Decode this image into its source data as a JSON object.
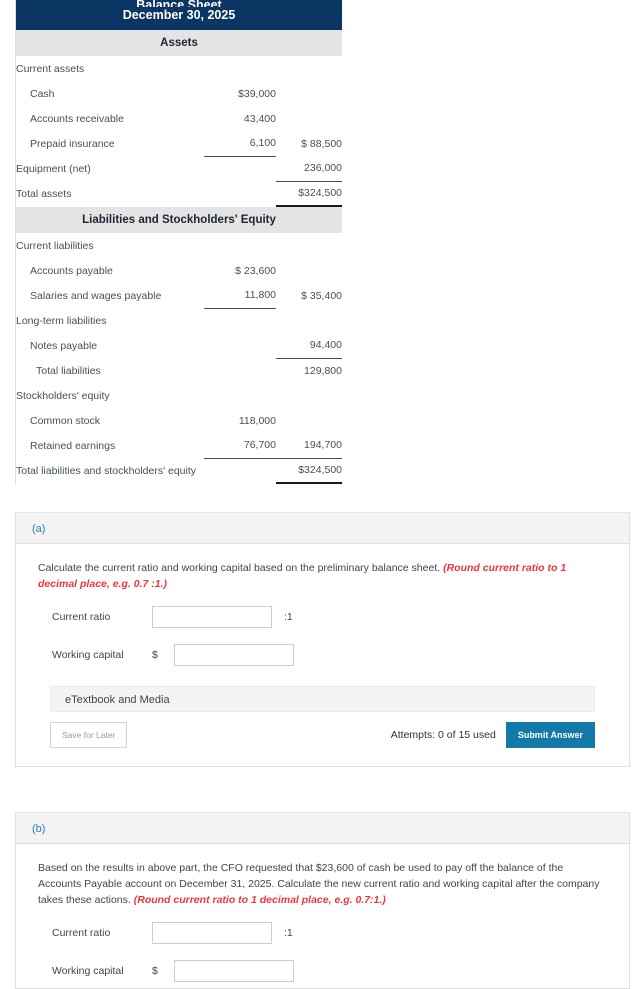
{
  "balance_sheet": {
    "title_line1": "Balance Sheet",
    "title_line2": "December 30, 2025",
    "assets_section": "Assets",
    "liabilities_section": "Liabilities and Stockholders' Equity",
    "asset_rows": [
      {
        "label": "Current assets",
        "col1": "",
        "col2": ""
      },
      {
        "label": "Cash",
        "col1": "$39,000",
        "col2": ""
      },
      {
        "label": "Accounts receivable",
        "col1": "43,400",
        "col2": ""
      },
      {
        "label": "Prepaid insurance",
        "col1": "6,100",
        "col2": "$ 88,500"
      },
      {
        "label": "Equipment (net)",
        "col1": "",
        "col2": "236,000"
      },
      {
        "label": "Total assets",
        "col1": "",
        "col2": "$324,500"
      }
    ],
    "liability_rows": [
      {
        "label": "Current liabilities",
        "col1": "",
        "col2": ""
      },
      {
        "label": "Accounts payable",
        "col1": "$ 23,600",
        "col2": ""
      },
      {
        "label": "Salaries and wages payable",
        "col1": "11,800",
        "col2": "$ 35,400"
      },
      {
        "label": "Long-term liabilities",
        "col1": "",
        "col2": ""
      },
      {
        "label": "Notes payable",
        "col1": "",
        "col2": "94,400"
      },
      {
        "label": "Total liabilities",
        "col1": "",
        "col2": "129,800"
      },
      {
        "label": "Stockholders' equity",
        "col1": "",
        "col2": ""
      },
      {
        "label": "Common stock",
        "col1": "118,000",
        "col2": ""
      },
      {
        "label": "Retained earnings",
        "col1": "76,700",
        "col2": "194,700"
      },
      {
        "label": "Total liabilities and stockholders' equity",
        "col1": "",
        "col2": "$324,500"
      }
    ]
  },
  "part_a": {
    "header": "(a)",
    "prompt_main": "Calculate the current ratio and working capital based on the preliminary balance sheet. ",
    "prompt_hint": "(Round current ratio to 1 decimal place, e.g. 0.7 :1.)",
    "current_ratio_label": "Current ratio",
    "current_ratio_value": "",
    "current_ratio_suffix": ":1",
    "working_capital_label": "Working capital",
    "working_capital_dollar": "$",
    "working_capital_value": "",
    "etextbook_label": "eTextbook and Media",
    "save_label": "Save for Later",
    "attempts_label": "Attempts: 0 of 15 used",
    "submit_label": "Submit Answer"
  },
  "part_b": {
    "header": "(b)",
    "prompt_main": "Based on the results in above part, the CFO requested that $23,600 of cash be used to pay off the balance of the Accounts Payable account on December 31, 2025. Calculate the new current ratio and working capital after the company takes these actions. ",
    "prompt_hint": "(Round current ratio to 1 decimal place, e.g. 0.7:1.)",
    "current_ratio_label": "Current ratio",
    "current_ratio_value": "",
    "current_ratio_suffix": ":1",
    "working_capital_label": "Working capital",
    "working_capital_dollar": "$",
    "working_capital_value": ""
  },
  "colors": {
    "header_navy": "#0b3562",
    "section_gray": "#e4e4e4",
    "accent_blue": "#2b7fb8",
    "submit_blue": "#1379a8",
    "hint_red": "#f0353b"
  }
}
